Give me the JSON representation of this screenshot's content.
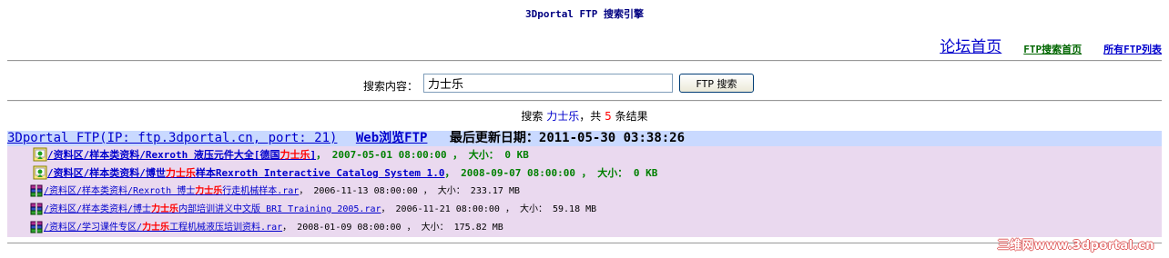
{
  "page": {
    "title": "3Dportal FTP 搜索引擎"
  },
  "nav": {
    "forum_home": "论坛首页",
    "ftp_search_home": "FTP搜索首页",
    "all_ftp_list": "所有FTP列表"
  },
  "search": {
    "label": "搜索内容：",
    "value": "力士乐",
    "button": "FTP 搜索"
  },
  "summary": {
    "prefix": "搜索",
    "query": "力士乐",
    "middle": "，共",
    "count": "5",
    "suffix": "条结果"
  },
  "site": {
    "name": "3Dportal FTP(IP: ftp.3dportal.cn, port: 21)",
    "browse": "Web浏览FTP",
    "updated_label": "最后更新日期：",
    "updated_value": "2011-05-30 03:38:26"
  },
  "results": [
    {
      "type": "folder",
      "icon": "folder-icon",
      "path_before": "/资料区/样本类资料/Rexroth 液压元件大全[德国",
      "highlight": "力士乐",
      "path_after": "]",
      "meta": "，  2007-05-01 08:00:00 ， 大小： 0 KB"
    },
    {
      "type": "folder",
      "icon": "folder-icon",
      "path_before": "/资料区/样本类资料/博世",
      "highlight": "力士乐",
      "path_after": "样本Rexroth Interactive Catalog System 1.0",
      "meta": "，  2008-09-07 08:00:00 ， 大小： 0 KB"
    },
    {
      "type": "file",
      "icon": "rar-archive-icon",
      "path_before": "/资料区/样本类资料/Rexroth 博士",
      "highlight": "力士乐",
      "path_after": "行走机械样本.rar",
      "meta": "，  2006-11-13 08:00:00 ， 大小： 233.17 MB"
    },
    {
      "type": "file",
      "icon": "rar-archive-icon",
      "path_before": "/资料区/样本类资料/博士",
      "highlight": "力士乐",
      "path_after": "内部培训讲义中文版 BRI Training 2005.rar",
      "meta": "，  2006-11-21 08:00:00 ， 大小： 59.18 MB"
    },
    {
      "type": "file",
      "icon": "rar-archive-icon",
      "path_before": "/资料区/学习课件专区/",
      "highlight": "力士乐",
      "path_after": "工程机械液压培训资料.rar",
      "meta": "，  2008-01-09 08:00:00 ， 大小： 175.82 MB"
    }
  ],
  "watermark": "三维网www.3dportal.cn",
  "colors": {
    "header_row": "#c9d9ff",
    "result_row": "#ead9ef",
    "link": "#0000cc",
    "highlight": "#ff0000",
    "folder_meta": "#008000",
    "title": "#000080"
  }
}
